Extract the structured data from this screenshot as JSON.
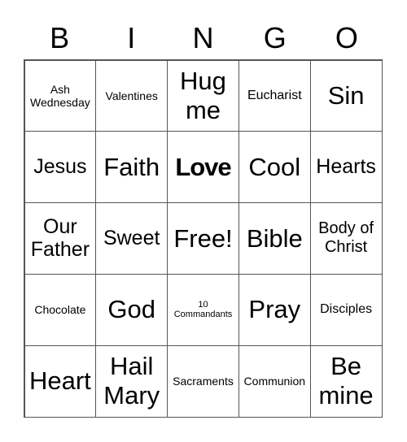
{
  "header": [
    "B",
    "I",
    "N",
    "G",
    "O"
  ],
  "cells": [
    {
      "text": "Ash Wednesday",
      "size": "s2"
    },
    {
      "text": "Valentines",
      "size": "s2"
    },
    {
      "text": "Hug me",
      "size": "s6"
    },
    {
      "text": "Eucharist",
      "size": "s3"
    },
    {
      "text": "Sin",
      "size": "s6"
    },
    {
      "text": "Jesus",
      "size": "s5"
    },
    {
      "text": "Faith",
      "size": "s6"
    },
    {
      "text": "Love",
      "size": "s6",
      "bold": true
    },
    {
      "text": "Cool",
      "size": "s6"
    },
    {
      "text": "Hearts",
      "size": "s5"
    },
    {
      "text": "Our Father",
      "size": "s5"
    },
    {
      "text": "Sweet",
      "size": "s5"
    },
    {
      "text": "Free!",
      "size": "s6"
    },
    {
      "text": "Bible",
      "size": "s6"
    },
    {
      "text": "Body of Christ",
      "size": "s4"
    },
    {
      "text": "Chocolate",
      "size": "s2"
    },
    {
      "text": "God",
      "size": "s6"
    },
    {
      "text": "10 Commandants",
      "size": "s1"
    },
    {
      "text": "Pray",
      "size": "s6"
    },
    {
      "text": "Disciples",
      "size": "s3"
    },
    {
      "text": "Heart",
      "size": "s6"
    },
    {
      "text": "Hail Mary",
      "size": "s6"
    },
    {
      "text": "Sacraments",
      "size": "s2"
    },
    {
      "text": "Communion",
      "size": "s2"
    },
    {
      "text": "Be mine",
      "size": "s6"
    }
  ]
}
